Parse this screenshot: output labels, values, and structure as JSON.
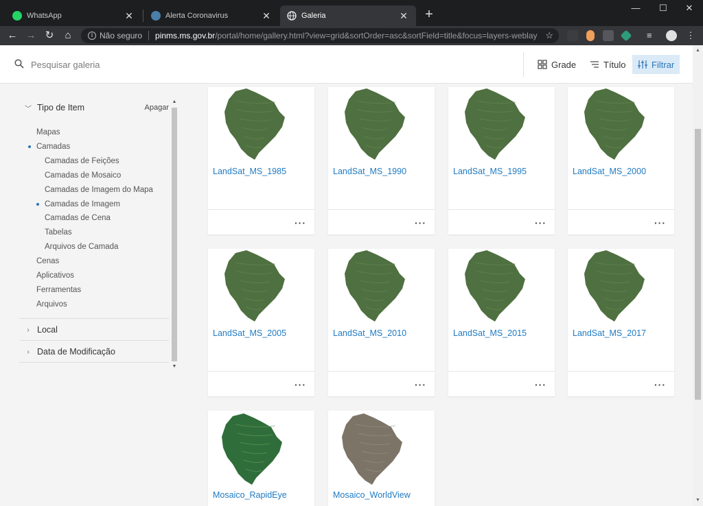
{
  "browser": {
    "tabs": [
      {
        "title": "WhatsApp",
        "icon": "whatsapp-icon"
      },
      {
        "title": "Alerta Coronavirus",
        "icon": "site-favicon-icon"
      },
      {
        "title": "Galeria",
        "icon": "globe-icon"
      }
    ],
    "security_label": "Não seguro",
    "url_domain": "pinms.ms.gov.br",
    "url_rest": "/portal/home/gallery.html?view=grid&sortOrder=asc&sortField=title&focus=layers-weblaye..."
  },
  "search": {
    "placeholder": "Pesquisar galeria"
  },
  "header_actions": {
    "grid_label": "Grade",
    "sort_label": "Título",
    "filter_label": "Filtrar"
  },
  "sidebar": {
    "item_type": {
      "title": "Tipo de Item",
      "clear_label": "Apagar",
      "items": [
        {
          "label": "Mapas",
          "level": 0,
          "selected": false
        },
        {
          "label": "Camadas",
          "level": 0,
          "selected": true
        },
        {
          "label": "Camadas de Feições",
          "level": 1,
          "selected": false
        },
        {
          "label": "Camadas de Mosaico",
          "level": 1,
          "selected": false
        },
        {
          "label": "Camadas de Imagem do Mapa",
          "level": 1,
          "selected": false
        },
        {
          "label": "Camadas de Imagem",
          "level": 1,
          "selected": true
        },
        {
          "label": "Camadas de Cena",
          "level": 1,
          "selected": false
        },
        {
          "label": "Tabelas",
          "level": 1,
          "selected": false
        },
        {
          "label": "Arquivos de Camada",
          "level": 1,
          "selected": false
        },
        {
          "label": "Cenas",
          "level": 0,
          "selected": false
        },
        {
          "label": "Aplicativos",
          "level": 0,
          "selected": false
        },
        {
          "label": "Ferramentas",
          "level": 0,
          "selected": false
        },
        {
          "label": "Arquivos",
          "level": 0,
          "selected": false
        }
      ]
    },
    "local_title": "Local",
    "modified_title": "Data de Modificação"
  },
  "gallery": {
    "items": [
      {
        "title": "LandSat_MS_1985",
        "thumb": "landsat"
      },
      {
        "title": "LandSat_MS_1990",
        "thumb": "landsat"
      },
      {
        "title": "LandSat_MS_1995",
        "thumb": "landsat"
      },
      {
        "title": "LandSat_MS_2000",
        "thumb": "landsat"
      },
      {
        "title": "LandSat_MS_2005",
        "thumb": "landsat"
      },
      {
        "title": "LandSat_MS_2010",
        "thumb": "landsat"
      },
      {
        "title": "LandSat_MS_2015",
        "thumb": "landsat"
      },
      {
        "title": "LandSat_MS_2017",
        "thumb": "landsat"
      },
      {
        "title": "Mosaico_RapidEye",
        "thumb": "rapideye"
      },
      {
        "title": "Mosaico_WorldView",
        "thumb": "worldview"
      }
    ],
    "more_label": "···"
  },
  "colors": {
    "accent": "#1f7ac2",
    "landsat_fill": "#4f7040",
    "rapideye_fill": "#2f6e3a",
    "worldview_fill": "#7c7567"
  }
}
